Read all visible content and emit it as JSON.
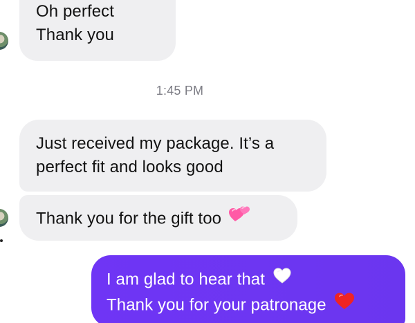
{
  "messages": {
    "incoming_1": {
      "line_1": "Oh perfect",
      "line_2": "Thank you"
    },
    "timestamp": "1:45 PM",
    "incoming_2": {
      "line_1": "Just received my package. It’s a",
      "line_2": "perfect fit and looks good"
    },
    "incoming_3": {
      "line_1": "Thank you for the gift too",
      "emoji": "two-hearts-icon"
    },
    "outgoing_1": {
      "line_1": "I am glad to hear that",
      "line_1_emoji": "white-heart-icon",
      "line_2": "Thank you for your patronage",
      "line_2_emoji": "red-heart-icon"
    }
  },
  "colors": {
    "incoming_bubble": "#efeff1",
    "outgoing_bubble": "#6f35f5",
    "text_dark": "#121212",
    "timestamp": "#7d7d85"
  }
}
